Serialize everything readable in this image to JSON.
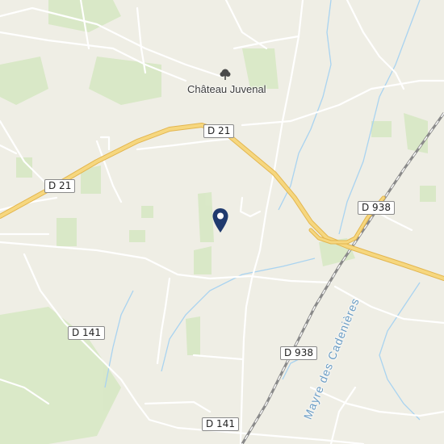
{
  "map": {
    "roads": {
      "d21_left": "D 21",
      "d21_top": "D 21",
      "d938_right": "D 938",
      "d938_bottom": "D 938",
      "d141_left": "D 141",
      "d141_bottom": "D 141"
    },
    "places": {
      "chateau": "Château Juvenal"
    },
    "waterways": {
      "mayre": "Mayre des Cadenières"
    },
    "icons": {
      "poi": "tree-icon",
      "marker": "location-pin-icon"
    },
    "colors": {
      "background": "#efeee5",
      "vegetation": "#d7e8c4",
      "major_road": "#f6d77f",
      "major_road_casing": "#e3b64f",
      "minor_road": "#ffffff",
      "water": "#a9d3f0",
      "railway": "#8a8a8a",
      "pin": "#1f3a6e"
    }
  }
}
